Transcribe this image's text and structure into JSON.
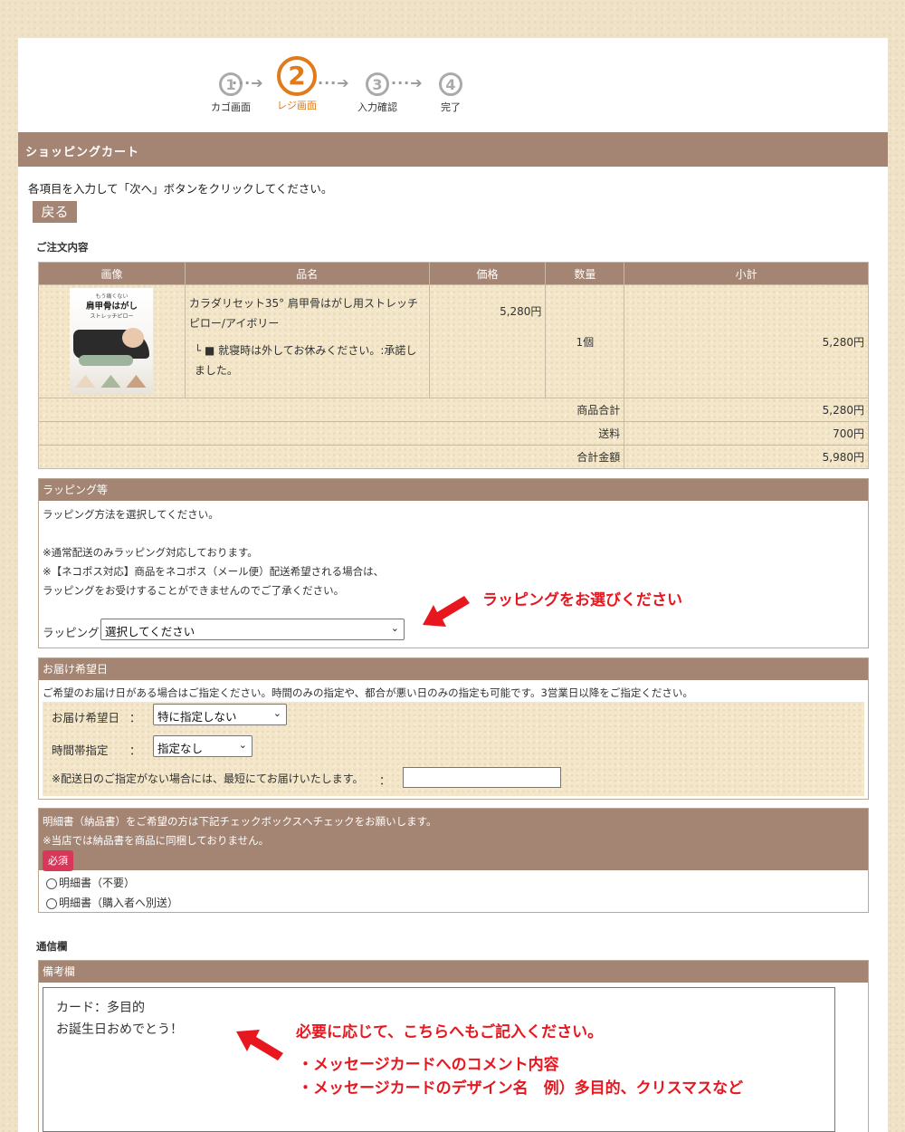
{
  "steps": [
    {
      "num": "1",
      "label": "カゴ画面"
    },
    {
      "num": "2",
      "label": "レジ画面"
    },
    {
      "num": "3",
      "label": "入力確認"
    },
    {
      "num": "4",
      "label": "完了"
    }
  ],
  "step_arrow": "···➔",
  "cart_header": "ショッピングカート",
  "instruction": "各項目を入力して「次へ」ボタンをクリックしてください。",
  "back_button": "戻る",
  "order": {
    "section_title": "ご注文内容",
    "columns": [
      "画像",
      "品名",
      "価格",
      "数量",
      "小計"
    ],
    "thumb_text": {
      "small": "もう痛くない",
      "main": "肩甲骨はがし",
      "sub": "ストレッチピロー"
    },
    "item": {
      "name": "カラダリセット35° 肩甲骨はがし用ストレッチピロー/アイボリー",
      "option": "└ ■ 就寝時は外してお休みください。:承諾しました。",
      "price": "5,280円",
      "qty": "1個",
      "subtotal": "5,280円"
    },
    "totals": [
      {
        "label": "商品合計",
        "value": "5,280円"
      },
      {
        "label": "送料",
        "value": "700円"
      },
      {
        "label": "合計金額",
        "value": "5,980円"
      }
    ]
  },
  "wrapping": {
    "header": "ラッピング等",
    "lines": [
      "ラッピング方法を選択してください。",
      "※通常配送のみラッピング対応しております。",
      "※【ネコポス対応】商品をネコポス（メール便）配送希望される場合は、",
      "ラッピングをお受けすることができませんのでご了承ください。"
    ],
    "select_label": "ラッピング",
    "select_value": "選択してください",
    "annotation": "ラッピングをお選びください"
  },
  "delivery": {
    "header": "お届け希望日",
    "note": "ご希望のお届け日がある場合はご指定ください。時間のみの指定や、都合が悪い日のみの指定も可能です。3営業日以降をご指定ください。",
    "date_label": "お届け希望日",
    "date_value": "特に指定しない",
    "time_label": "時間帯指定",
    "time_value": "指定なし",
    "colon": "：",
    "nodate_label": "※配送日のご指定がない場合には、最短にてお届けいたします。",
    "nodate_value": ""
  },
  "invoice": {
    "line1": "明細書（納品書）をご希望の方は下記チェックボックスへチェックをお願いします。",
    "line2": "※当店では納品書を商品に同梱しておりません。",
    "required": "必須",
    "options": [
      "明細書（不要）",
      "明細書（購入者へ別送）"
    ]
  },
  "comm": {
    "section_title": "通信欄",
    "header": "備考欄",
    "textarea_line1": "カード：多目的",
    "textarea_line2": "お誕生日おめでとう！",
    "annotation_title": "必要に応じて、こちらへもご記入ください。",
    "annotation_line1": "・メッセージカードへのコメント内容",
    "annotation_line2": "・メッセージカードのデザイン名　例）多目的、クリスマスなど"
  },
  "colors": {
    "header_brown": "#a48472",
    "active_step": "#e07a1a",
    "annotation_red": "#e8161e",
    "required_badge": "#d8375a"
  }
}
